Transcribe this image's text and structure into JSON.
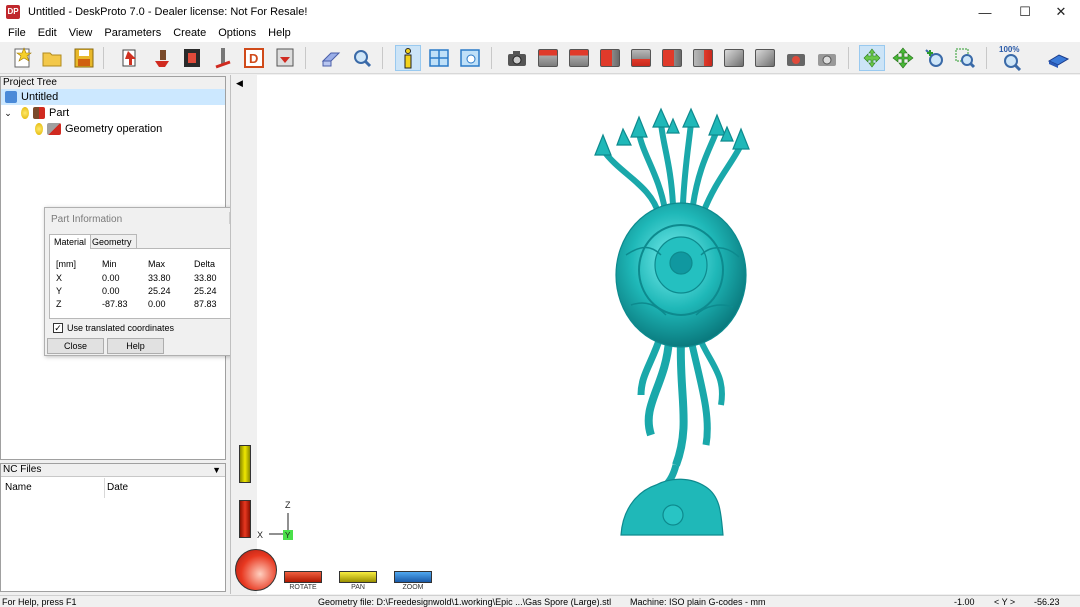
{
  "window": {
    "title": "Untitled - DeskProto 7.0 - Dealer license: Not For Resale!",
    "logo_text": "DP",
    "minimize": "—",
    "maximize": "☐",
    "close": "✕"
  },
  "menu": [
    "File",
    "Edit",
    "View",
    "Parameters",
    "Create",
    "Options",
    "Help"
  ],
  "toolbar": {
    "zoom_label": "100%"
  },
  "project_tree": {
    "header": "Project Tree",
    "root": "Untitled",
    "part": "Part",
    "operation": "Geometry operation"
  },
  "part_info": {
    "title": "Part Information",
    "tabs": [
      "Material",
      "Geometry"
    ],
    "columns": [
      "[mm]",
      "Min",
      "Max",
      "Delta"
    ],
    "rows": [
      [
        "X",
        "0.00",
        "33.80",
        "33.80"
      ],
      [
        "Y",
        "0.00",
        "25.24",
        "25.24"
      ],
      [
        "Z",
        "-87.83",
        "0.00",
        "87.83"
      ]
    ],
    "checkbox_label": "Use translated coordinates",
    "checkbox_checked": true,
    "checkmark": "✓",
    "close_button": "Close",
    "help_button": "Help"
  },
  "nc_files": {
    "header": "NC Files",
    "columns": [
      "Name",
      "Date"
    ]
  },
  "viewport": {
    "model_color": "#1fb8b8",
    "axis_z": "Z",
    "axis_x": "X",
    "axis_y": "Y",
    "tools": [
      "ROTATE",
      "PAN",
      "ZOOM"
    ]
  },
  "statusbar": {
    "help": "For Help, press F1",
    "geometry_file": "Geometry file: D:\\Freedesignwold\\1.working\\Epic ...\\Gas Spore (Large).stl",
    "machine": "Machine: ISO plain G-codes - mm",
    "coord_x": "-1.00",
    "coord_label": "< Y >",
    "coord_y": "-56.23"
  }
}
